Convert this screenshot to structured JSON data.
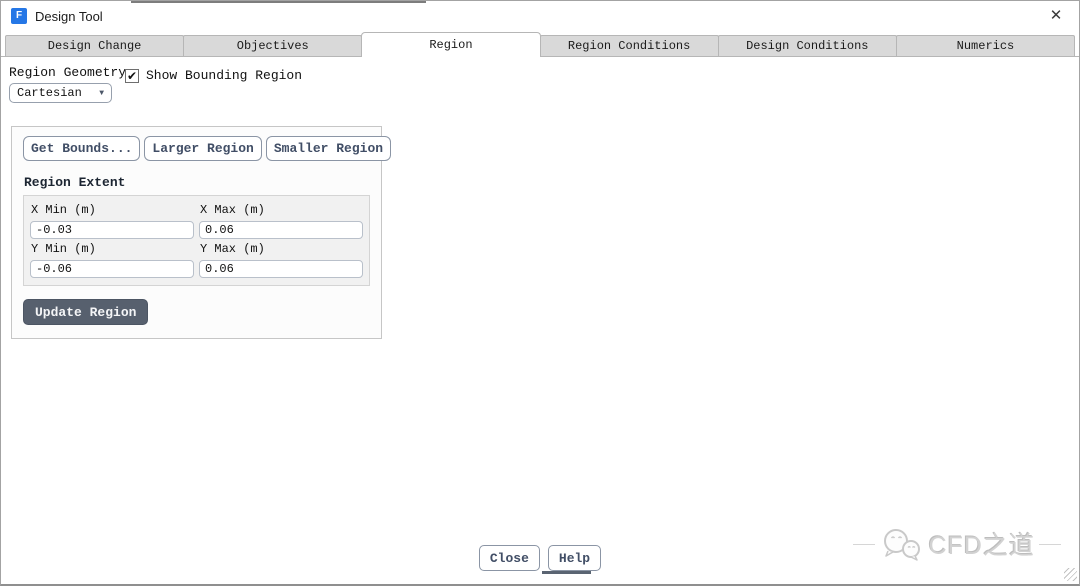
{
  "window": {
    "title": "Design Tool",
    "app_icon_letter": "F"
  },
  "icons": {
    "close": "✕",
    "check": "✔",
    "dropdown_arrow": "▼"
  },
  "tabs": [
    {
      "label": "Design Change"
    },
    {
      "label": "Objectives"
    },
    {
      "label": "Region"
    },
    {
      "label": "Region Conditions"
    },
    {
      "label": "Design Conditions"
    },
    {
      "label": "Numerics"
    }
  ],
  "active_tab": "Region",
  "region_tab": {
    "geometry_label": "Region Geometry",
    "geometry_value": "Cartesian",
    "show_bounding_label": "Show Bounding Region",
    "show_bounding_checked": true,
    "buttons": {
      "get_bounds": "Get Bounds...",
      "larger": "Larger Region",
      "smaller": "Smaller Region",
      "update": "Update Region"
    },
    "extent": {
      "title": "Region Extent",
      "fields": [
        {
          "label": "X Min (m)",
          "value": "-0.03"
        },
        {
          "label": "X Max (m)",
          "value": "0.06"
        },
        {
          "label": "Y Min (m)",
          "value": "-0.06"
        },
        {
          "label": "Y Max (m)",
          "value": "0.06"
        }
      ]
    }
  },
  "footer": {
    "close": "Close",
    "help": "Help"
  },
  "watermark": {
    "text": "CFD之道"
  },
  "colors": {
    "accent_blue": "#2577e6",
    "button_text": "#414e66",
    "update_button_bg": "#57606e",
    "tab_inactive_bg": "#d9d9d9",
    "panel_bg": "#f1f1f1"
  }
}
